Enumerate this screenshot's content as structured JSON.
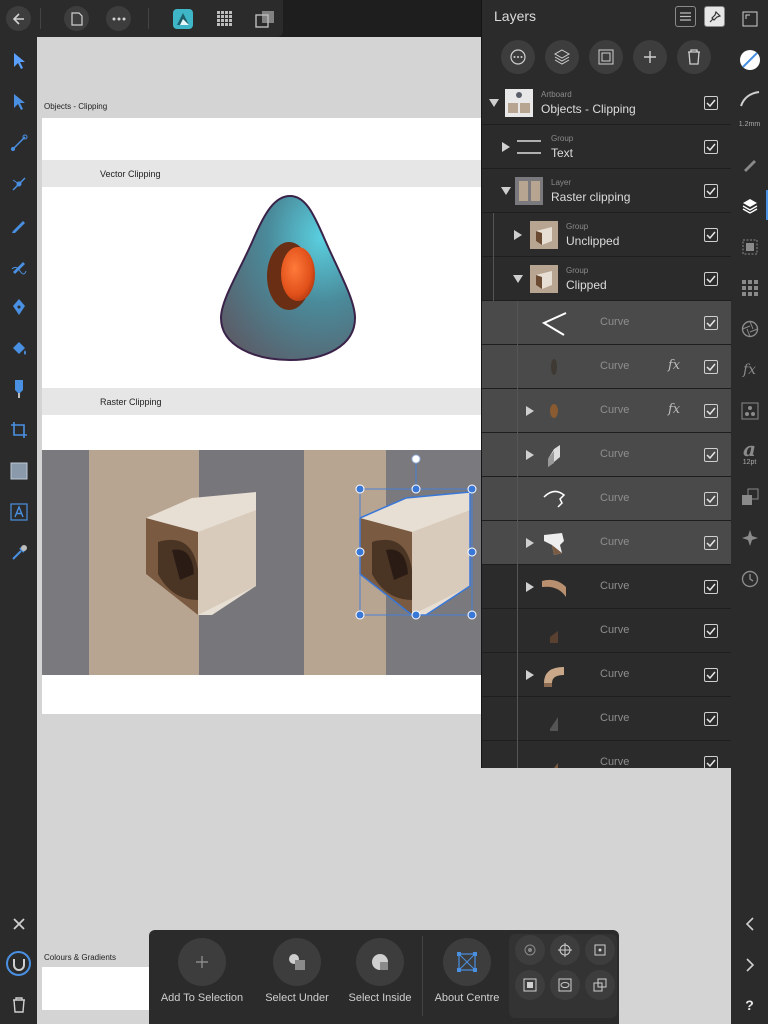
{
  "canvas": {
    "artboard_title": "Objects - Clipping",
    "sections": {
      "vector": "Vector Clipping",
      "raster": "Raster Clipping",
      "colours": "Colours & Gradients"
    }
  },
  "layers_panel": {
    "title": "Layers",
    "rows": [
      {
        "type": "Artboard",
        "name": "Objects - Clipping",
        "expanded": true,
        "checked": true
      },
      {
        "type": "Group",
        "name": "Text",
        "expanded": false,
        "checked": true
      },
      {
        "type": "Layer",
        "name": "Raster clipping",
        "expanded": true,
        "checked": true
      },
      {
        "type": "Group",
        "name": "Unclipped",
        "expanded": false,
        "checked": true
      },
      {
        "type": "Group",
        "name": "Clipped",
        "expanded": true,
        "checked": true
      },
      {
        "name": "Curve",
        "fx": false,
        "arrow": false,
        "checked": true
      },
      {
        "name": "Curve",
        "fx": true,
        "arrow": false,
        "checked": true
      },
      {
        "name": "Curve",
        "fx": true,
        "arrow": true,
        "checked": true
      },
      {
        "name": "Curve",
        "fx": false,
        "arrow": true,
        "checked": true
      },
      {
        "name": "Curve",
        "fx": false,
        "arrow": false,
        "checked": true
      },
      {
        "name": "Curve",
        "fx": false,
        "arrow": true,
        "checked": true
      },
      {
        "name": "Curve",
        "fx": false,
        "arrow": true,
        "checked": true
      },
      {
        "name": "Curve",
        "fx": false,
        "arrow": false,
        "checked": true
      },
      {
        "name": "Curve",
        "fx": false,
        "arrow": true,
        "checked": true
      },
      {
        "name": "Curve",
        "fx": false,
        "arrow": false,
        "checked": true
      },
      {
        "name": "Curve",
        "fx": false,
        "arrow": false,
        "checked": true
      }
    ],
    "fx_label": "fx"
  },
  "right_bar": {
    "stroke_width": "1.2mm",
    "text_size": "12pt",
    "text_glyph": "a",
    "fx_label": "fx",
    "help": "?"
  },
  "context_toolbar": {
    "add_to_selection": "Add To Selection",
    "select_under": "Select Under",
    "select_inside": "Select Inside",
    "about_centre": "About Centre"
  },
  "colors": {
    "accent": "#4a90e2",
    "panel_bg": "#2a2a2a",
    "canvas_bg": "#d4d4d4"
  }
}
